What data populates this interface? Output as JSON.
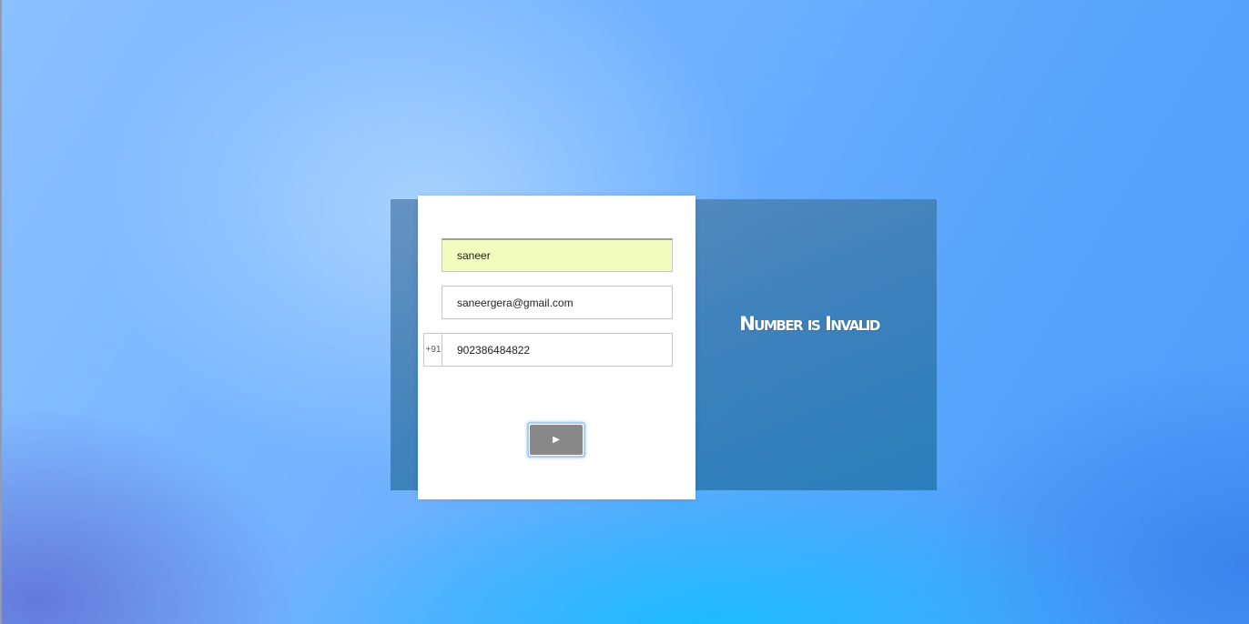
{
  "form": {
    "name_value": "saneer",
    "email_value": "saneergera@gmail.com",
    "phone_prefix": "+91",
    "phone_value": "902386484822",
    "submit_glyph": "▶",
    "submit_icon": "play-icon"
  },
  "status": {
    "message": "Number is Invalid"
  },
  "colors": {
    "autofill_background": "#f2fcbc",
    "button_background": "#888888",
    "panel_background": "#3f7fb5"
  }
}
